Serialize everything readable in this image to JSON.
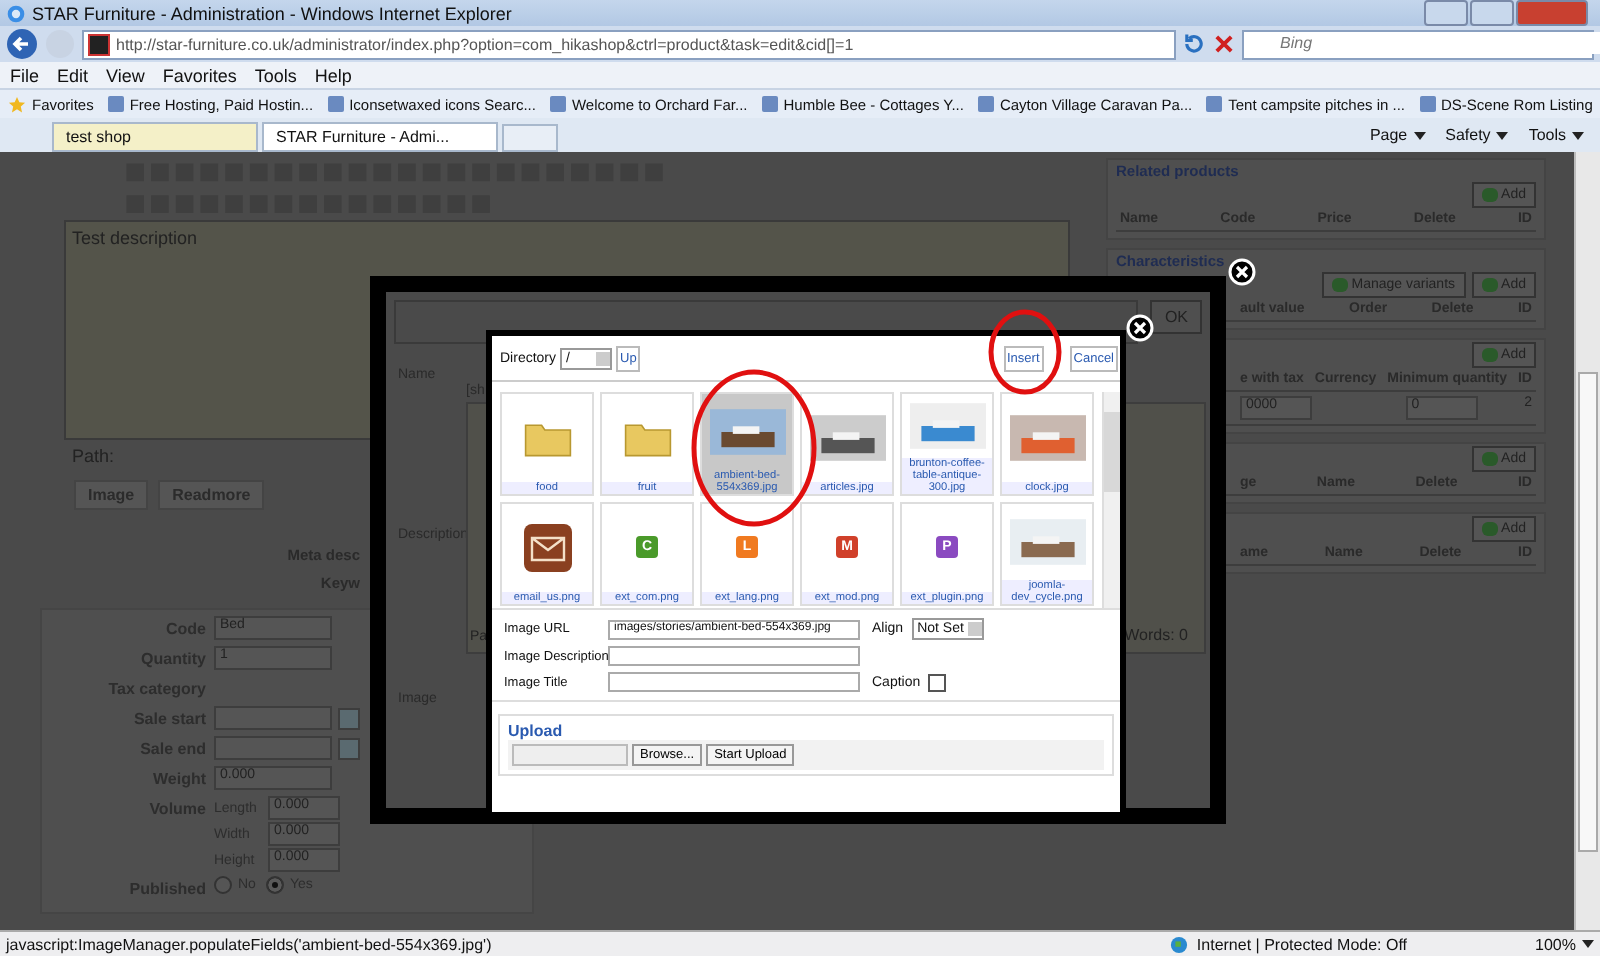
{
  "window": {
    "title": "STAR Furniture - Administration - Windows Internet Explorer"
  },
  "address_bar": {
    "url": "http://star-furniture.co.uk/administrator/index.php?option=com_hikashop&ctrl=product&task=edit&cid[]=1",
    "search_placeholder": "Bing"
  },
  "menu": [
    "File",
    "Edit",
    "View",
    "Favorites",
    "Tools",
    "Help"
  ],
  "favorites_bar": {
    "label": "Favorites",
    "links": [
      "Free Hosting, Paid Hostin...",
      "Iconsetwaxed icons  Searc...",
      "Welcome to Orchard Far...",
      "Humble Bee - Cottages Y...",
      "Cayton Village Caravan Pa...",
      "Tent campsite pitches in ...",
      "DS-Scene Rom Listing"
    ]
  },
  "tabs": [
    {
      "label": "test shop",
      "selected": false
    },
    {
      "label": "STAR Furniture - Admi...",
      "selected": true
    }
  ],
  "command_bar": [
    "Page",
    "Safety",
    "Tools"
  ],
  "editor": {
    "text": "Test description",
    "path_label": "Path:",
    "buttons": [
      "Image",
      "Readmore"
    ],
    "meta_labels": [
      "Meta desc",
      "Keyw"
    ]
  },
  "product_fields": [
    {
      "label": "Code",
      "kind": "text",
      "value": "Bed"
    },
    {
      "label": "Quantity",
      "kind": "text",
      "value": "1"
    },
    {
      "label": "Tax category",
      "kind": "none"
    },
    {
      "label": "Sale start",
      "kind": "date"
    },
    {
      "label": "Sale end",
      "kind": "date"
    },
    {
      "label": "Weight",
      "kind": "text",
      "value": "0.000"
    },
    {
      "label": "Volume",
      "kind": "dimensions",
      "parts": [
        {
          "label": "Length",
          "value": "0.000"
        },
        {
          "label": "Width",
          "value": "0.000"
        },
        {
          "label": "Height",
          "value": "0.000"
        }
      ]
    },
    {
      "label": "Published",
      "kind": "radio",
      "options": [
        {
          "label": "No",
          "selected": false
        },
        {
          "label": "Yes",
          "selected": true
        }
      ]
    }
  ],
  "right_panels": [
    {
      "title": "Related products",
      "buttons": [
        "Add"
      ],
      "columns": [
        "Name",
        "Code",
        "Price",
        "Delete",
        "ID"
      ]
    },
    {
      "title": "Characteristics",
      "buttons": [
        "Manage variants",
        "Add"
      ],
      "columns": [
        "ault value",
        "Order",
        "Delete",
        "ID"
      ]
    },
    {
      "buttons": [
        "Add"
      ],
      "columns": [
        "e with tax",
        "Currency",
        "Minimum quantity",
        "ID"
      ],
      "row": [
        {
          "kind": "input",
          "value": "0000"
        },
        {
          "kind": "text"
        },
        {
          "kind": "input",
          "value": "0"
        },
        {
          "kind": "text",
          "value": "2"
        }
      ]
    },
    {
      "buttons": [
        "Add"
      ],
      "columns": [
        "ge",
        "Name",
        "Delete",
        "ID"
      ]
    },
    {
      "buttons": [
        "Add"
      ],
      "columns": [
        "ame",
        "Name",
        "Delete",
        "ID"
      ]
    }
  ],
  "outer_dialog": {
    "ok_button": "OK",
    "labels": [
      "Name",
      "Description",
      "Image"
    ],
    "name_hint": "[sh",
    "path_label": "Pa",
    "word_count": "Words: 0"
  },
  "image_manager": {
    "directory_label": "Directory",
    "directory": "/",
    "up_button": "Up",
    "insert_button": "Insert",
    "cancel_button": "Cancel",
    "files": [
      {
        "name": "food",
        "kind": "folder",
        "selected": false
      },
      {
        "name": "fruit",
        "kind": "folder",
        "selected": false
      },
      {
        "name": "ambient-bed-554x369.jpg",
        "selected": true
      },
      {
        "name": "articles.jpg",
        "selected": false
      },
      {
        "name": "brunton-coffee-table-antique-300.jpg",
        "selected": false
      },
      {
        "name": "clock.jpg",
        "selected": false
      },
      {
        "name": "email_us.png",
        "kind": "envelope",
        "selected": false
      },
      {
        "name": "ext_com.png",
        "kind": "letter",
        "letter": "C",
        "color": "#4a9a2a",
        "selected": false
      },
      {
        "name": "ext_lang.png",
        "kind": "letter",
        "letter": "L",
        "color": "#f07a20",
        "selected": false
      },
      {
        "name": "ext_mod.png",
        "kind": "letter",
        "letter": "M",
        "color": "#d0402a",
        "selected": false
      },
      {
        "name": "ext_plugin.png",
        "kind": "letter",
        "letter": "P",
        "color": "#8a4ac0",
        "selected": false
      },
      {
        "name": "joomla-dev_cycle.png",
        "selected": false
      }
    ],
    "fields": {
      "image_url_label": "Image URL",
      "image_url": "images/stories/ambient-bed-554x369.jpg",
      "align_label": "Align",
      "align": "Not Set",
      "description_label": "Image Description",
      "title_label": "Image Title",
      "caption_label": "Caption",
      "caption_checked": false
    },
    "upload": {
      "legend": "Upload",
      "browse_button": "Browse...",
      "start_button": "Start Upload"
    }
  },
  "status_bar": {
    "text": "javascript:ImageManager.populateFields('ambient-bed-554x369.jpg')",
    "zone": "Internet | Protected Mode: Off",
    "zoom": "100%"
  }
}
